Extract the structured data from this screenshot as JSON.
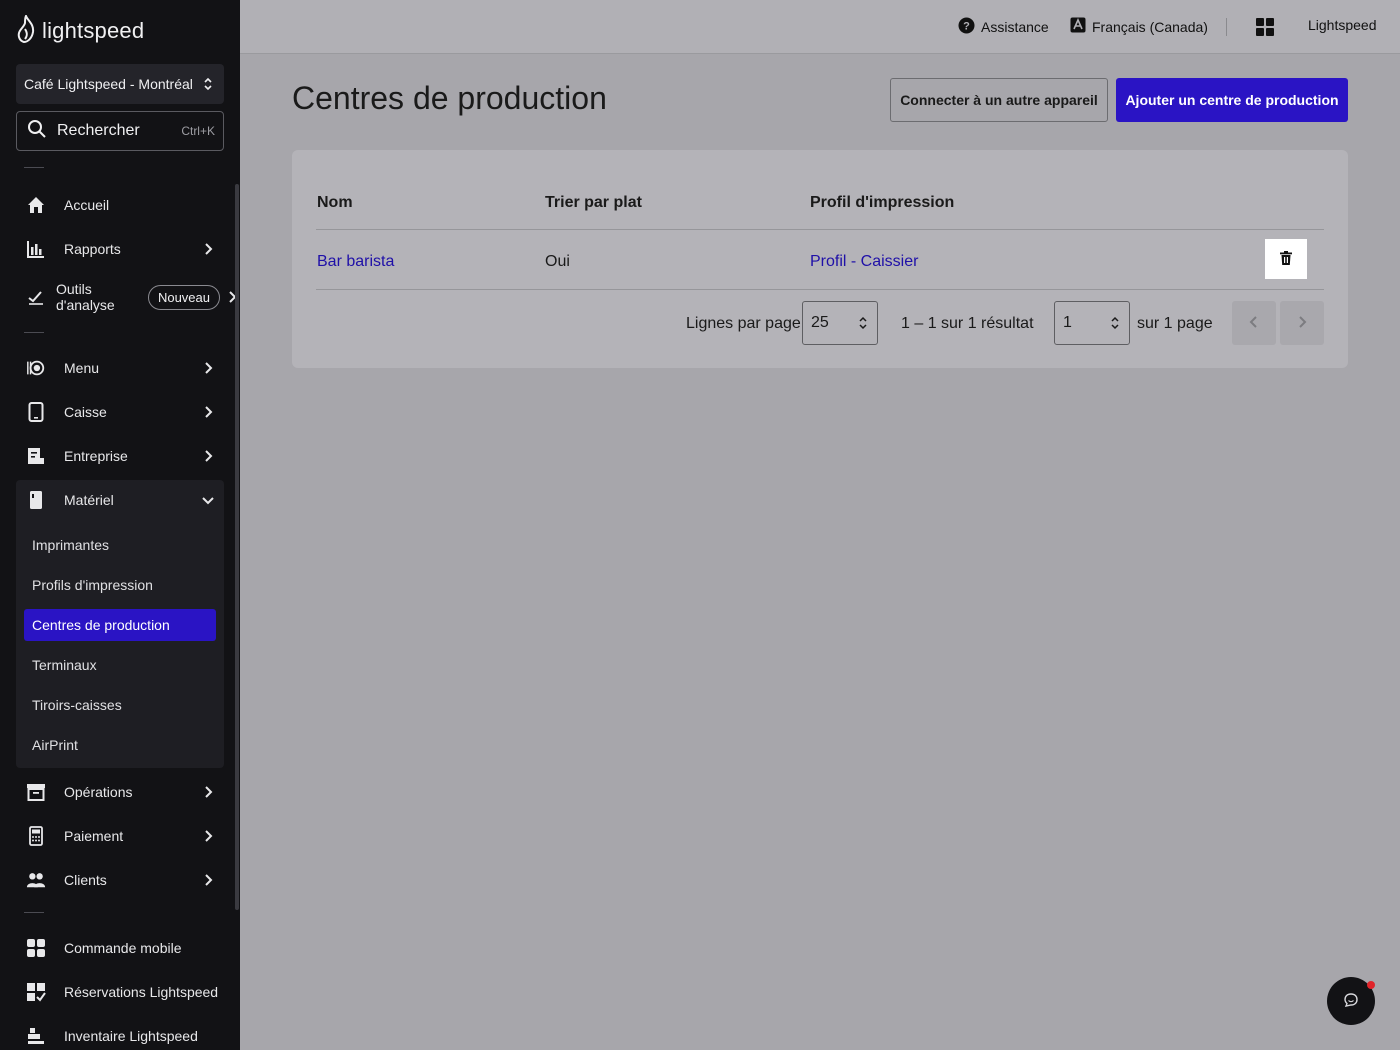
{
  "brand": {
    "logo_text": "lightspeed"
  },
  "sidebar": {
    "store": "Café Lightspeed - Montréal",
    "search": {
      "label": "Rechercher",
      "shortcut": "Ctrl+K"
    },
    "items": [
      {
        "label": "Accueil",
        "icon": "home-icon"
      },
      {
        "label": "Rapports",
        "icon": "bar-chart-icon"
      },
      {
        "label": "Outils d'analyse",
        "line1": "Outils",
        "line2": "d'analyse",
        "badge": "Nouveau",
        "icon": "analytics-icon"
      },
      {
        "label": "Menu",
        "icon": "menu-icon"
      },
      {
        "label": "Caisse",
        "icon": "tablet-icon"
      },
      {
        "label": "Entreprise",
        "icon": "business-icon"
      },
      {
        "label": "Matériel",
        "icon": "hardware-icon",
        "expanded": true
      },
      {
        "label": "Opérations",
        "icon": "archive-icon"
      },
      {
        "label": "Paiement",
        "icon": "payment-terminal-icon"
      },
      {
        "label": "Clients",
        "icon": "people-icon"
      },
      {
        "label": "Commande mobile",
        "icon": "grid-icon"
      },
      {
        "label": "Réservations Lightspeed",
        "icon": "reservations-icon"
      },
      {
        "label": "Inventaire Lightspeed",
        "icon": "inventory-icon"
      }
    ],
    "materiel_subitems": [
      {
        "label": "Imprimantes"
      },
      {
        "label": "Profils d'impression"
      },
      {
        "label": "Centres de production",
        "active": true
      },
      {
        "label": "Terminaux"
      },
      {
        "label": "Tiroirs-caisses"
      },
      {
        "label": "AirPrint"
      }
    ]
  },
  "topbar": {
    "assistance": "Assistance",
    "language": "Français (Canada)",
    "account": "Lightspeed"
  },
  "page": {
    "title": "Centres de production",
    "connect_button": "Connecter à un autre appareil",
    "add_button": "Ajouter un centre de production"
  },
  "table": {
    "columns": [
      "Nom",
      "Trier par plat",
      "Profil d'impression"
    ],
    "rows": [
      {
        "name": "Bar barista",
        "sort_by_dish": "Oui",
        "print_profile": "Profil - Caissier"
      }
    ]
  },
  "pagination": {
    "rows_per_page_label": "Lignes par page",
    "rows_per_page": "25",
    "range_text": "1 – 1 sur 1 résultat",
    "page": "1",
    "of_pages": "sur 1 page"
  },
  "colors": {
    "accent": "#2a14c4",
    "link": "#1f10a8",
    "sidebar_bg": "#121215",
    "notification": "#e0242a"
  }
}
